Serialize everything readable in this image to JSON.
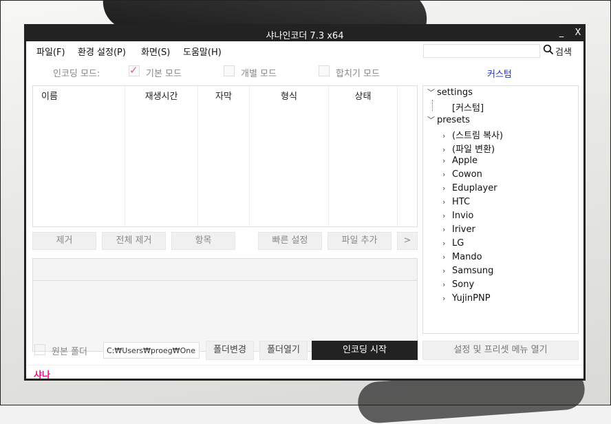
{
  "window": {
    "title": "샤나인코더  7.3  x64",
    "minimize": "_",
    "close": "X"
  },
  "menu": [
    {
      "label": "파일(F)"
    },
    {
      "label": "환경 설정(P)"
    },
    {
      "label": "화면(S)"
    },
    {
      "label": "도움말(H)"
    }
  ],
  "search": {
    "placeholder": "",
    "value": "",
    "label": "검색"
  },
  "mode": {
    "label": "인코딩 모드:",
    "options": [
      {
        "label": "기본 모드",
        "checked": true
      },
      {
        "label": "개별 모드",
        "checked": false
      },
      {
        "label": "합치기 모드",
        "checked": false
      }
    ],
    "custom_link": "커스텀"
  },
  "filelist": {
    "columns": [
      "이름",
      "재생시간",
      "자막",
      "형식",
      "상태"
    ]
  },
  "buttons": {
    "remove": "제거",
    "remove_all": "전체 제거",
    "items": "항목",
    "quick_settings": "빠른 설정",
    "add_file": "파일 추가",
    "more": ">"
  },
  "tree": {
    "settings": {
      "label": "settings",
      "children": [
        "[커스텀]"
      ]
    },
    "presets": {
      "label": "presets",
      "children": [
        "(스트림 복사)",
        "(파일 변환)",
        "Apple",
        "Cowon",
        "Eduplayer",
        "HTC",
        "Invio",
        "Iriver",
        "LG",
        "Mando",
        "Samsung",
        "Sony",
        "YujinPNP"
      ]
    }
  },
  "bottom": {
    "original_folder": "원본 폴더",
    "path_value": "C:₩Users₩proeg₩One",
    "change_folder": "폴더변경",
    "open_folder": "폴더열기",
    "start_encoding": "인코딩 시작",
    "settings_menu": "설정 및 프리셋 메뉴 열기"
  },
  "status": {
    "text": "샤나"
  },
  "colors": {
    "accent_pink": "#e0187a",
    "link_blue": "#1d2fd0",
    "titlebar": "#222222"
  }
}
